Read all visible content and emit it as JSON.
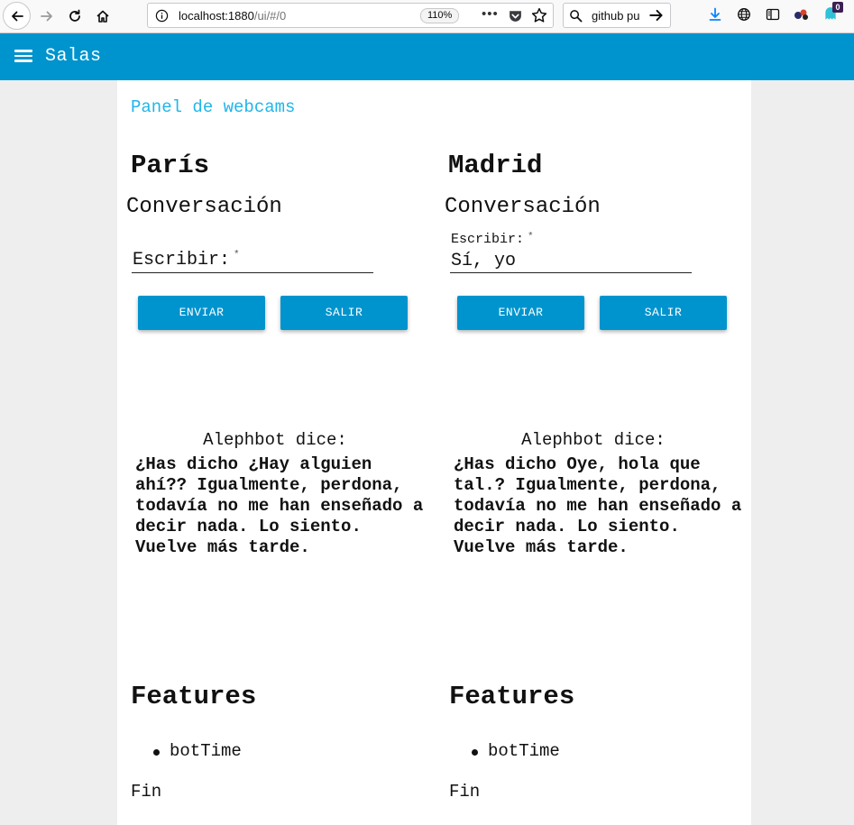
{
  "browser": {
    "url_host": "localhost:1880",
    "url_path": "/ui/#/0",
    "zoom": "110%",
    "more_label": "•••",
    "search_text": "github pu",
    "ext_badge": "0"
  },
  "app": {
    "title": "Salas",
    "group_title": "Panel de webcams"
  },
  "rooms": [
    {
      "name": "París",
      "conversation_title": "Conversación",
      "input_label": "Escribir:",
      "input_required_mark": "*",
      "input_value": "",
      "send_label": "ENVIAR",
      "exit_label": "SALIR",
      "bot_header": "Alephbot dice:",
      "bot_message": "¿Has dicho ¿Hay alguien ahí?? Igualmente, perdona, todavía no me han enseñado a decir nada. Lo siento. Vuelve más tarde.",
      "features_title": "Features",
      "features": [
        "botTime"
      ],
      "footer": "Fin"
    },
    {
      "name": "Madrid",
      "conversation_title": "Conversación",
      "input_label": "Escribir:",
      "input_required_mark": "*",
      "input_value": "Sí, yo",
      "send_label": "ENVIAR",
      "exit_label": "SALIR",
      "bot_header": "Alephbot dice:",
      "bot_message": "¿Has dicho Oye, hola que tal.? Igualmente, perdona, todavía no me han enseñado a decir nada. Lo siento. Vuelve más tarde.",
      "features_title": "Features",
      "features": [
        "botTime"
      ],
      "footer": "Fin"
    }
  ],
  "colors": {
    "toolbar": "#0094ce",
    "button": "#0094ce",
    "group_title": "#1fb6ea",
    "background": "#eeeeee"
  }
}
